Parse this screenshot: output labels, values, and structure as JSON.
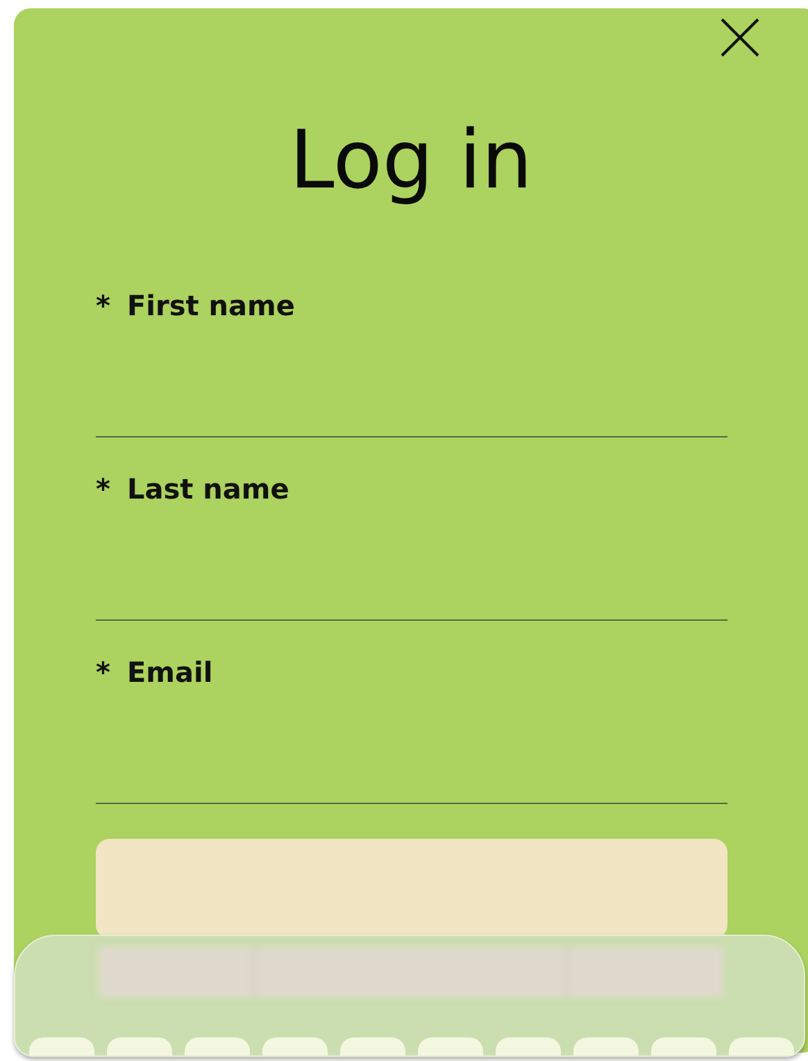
{
  "dialog": {
    "title": "Log in"
  },
  "fields": [
    {
      "label": "First name",
      "required_mark": "*"
    },
    {
      "label": "Last name",
      "required_mark": "*"
    },
    {
      "label": "Email",
      "required_mark": "*"
    }
  ]
}
